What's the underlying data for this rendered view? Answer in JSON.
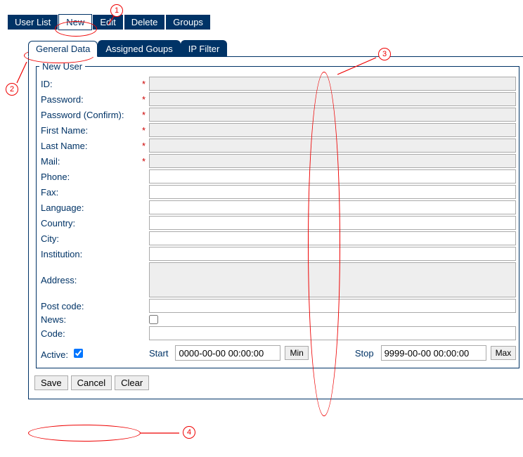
{
  "toolbar": {
    "user_list": "User List",
    "new": "New",
    "edit": "Edit",
    "delete": "Delete",
    "groups": "Groups"
  },
  "tabs": {
    "general": "General Data",
    "groups": "Assigned Goups",
    "ipfilter": "IP Filter"
  },
  "form": {
    "legend": "New User",
    "fields": {
      "id": "ID:",
      "password": "Password:",
      "password2": "Password (Confirm):",
      "first_name": "First Name:",
      "last_name": "Last Name:",
      "mail": "Mail:",
      "phone": "Phone:",
      "fax": "Fax:",
      "language": "Language:",
      "country": "Country:",
      "city": "City:",
      "institution": "Institution:",
      "address": "Address:",
      "post_code": "Post code:",
      "news": "News:",
      "code": "Code:"
    },
    "active": {
      "label": "Active:",
      "checked": true,
      "start_label": "Start",
      "start_value": "0000-00-00 00:00:00",
      "min_btn": "Min",
      "stop_label": "Stop",
      "stop_value": "9999-00-00 00:00:00",
      "max_btn": "Max"
    }
  },
  "actions": {
    "save": "Save",
    "cancel": "Cancel",
    "clear": "Clear"
  },
  "annotations": {
    "n1": "1",
    "n2": "2",
    "n3": "3",
    "n4": "4"
  }
}
